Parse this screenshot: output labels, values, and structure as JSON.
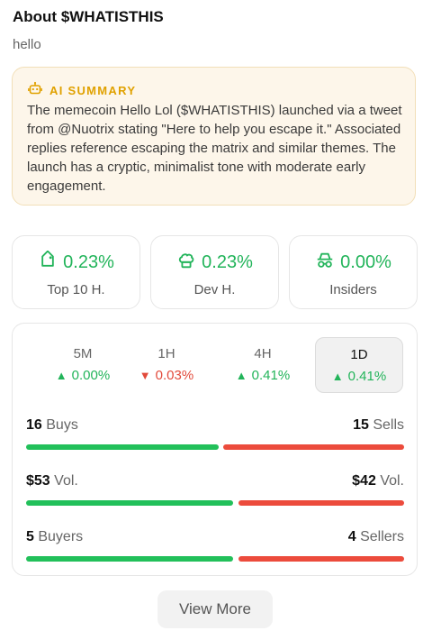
{
  "about": {
    "title": "About $WHATISTHIS",
    "subtitle": "hello"
  },
  "summary": {
    "icon": "robot-icon",
    "label": "AI SUMMARY",
    "text": "The memecoin Hello Lol ($WHATISTHIS) launched via a tweet from @Nuotrix stating \"Here to help you escape it.\" Associated replies reference escaping the matrix and similar themes. The launch has a cryptic, minimalist tone with moderate early engagement."
  },
  "stats": [
    {
      "icon": "tag-icon",
      "value": "0.23%",
      "label": "Top 10 H."
    },
    {
      "icon": "chef-hat-icon",
      "value": "0.23%",
      "label": "Dev H."
    },
    {
      "icon": "incognito-icon",
      "value": "0.00%",
      "label": "Insiders"
    }
  ],
  "timeframes": [
    {
      "name": "5M",
      "change": "0.00%",
      "direction": "up",
      "active": false
    },
    {
      "name": "1H",
      "change": "0.03%",
      "direction": "down",
      "active": false
    },
    {
      "name": "4H",
      "change": "0.41%",
      "direction": "up",
      "active": false
    },
    {
      "name": "1D",
      "change": "0.41%",
      "direction": "up",
      "active": true
    }
  ],
  "activity": {
    "buys": {
      "count": "16",
      "label": "Buys"
    },
    "sells": {
      "count": "15",
      "label": "Sells"
    },
    "buy_vol": {
      "value": "$53",
      "label": "Vol."
    },
    "sell_vol": {
      "value": "$42",
      "label": "Vol."
    },
    "buyers": {
      "count": "5",
      "label": "Buyers"
    },
    "sellers": {
      "count": "4",
      "label": "Sellers"
    }
  },
  "view_more_label": "View More",
  "colors": {
    "positive": "#22c05a",
    "negative": "#ec4b3c",
    "summary_accent": "#e0a100",
    "summary_bg": "#fdf6ea"
  }
}
